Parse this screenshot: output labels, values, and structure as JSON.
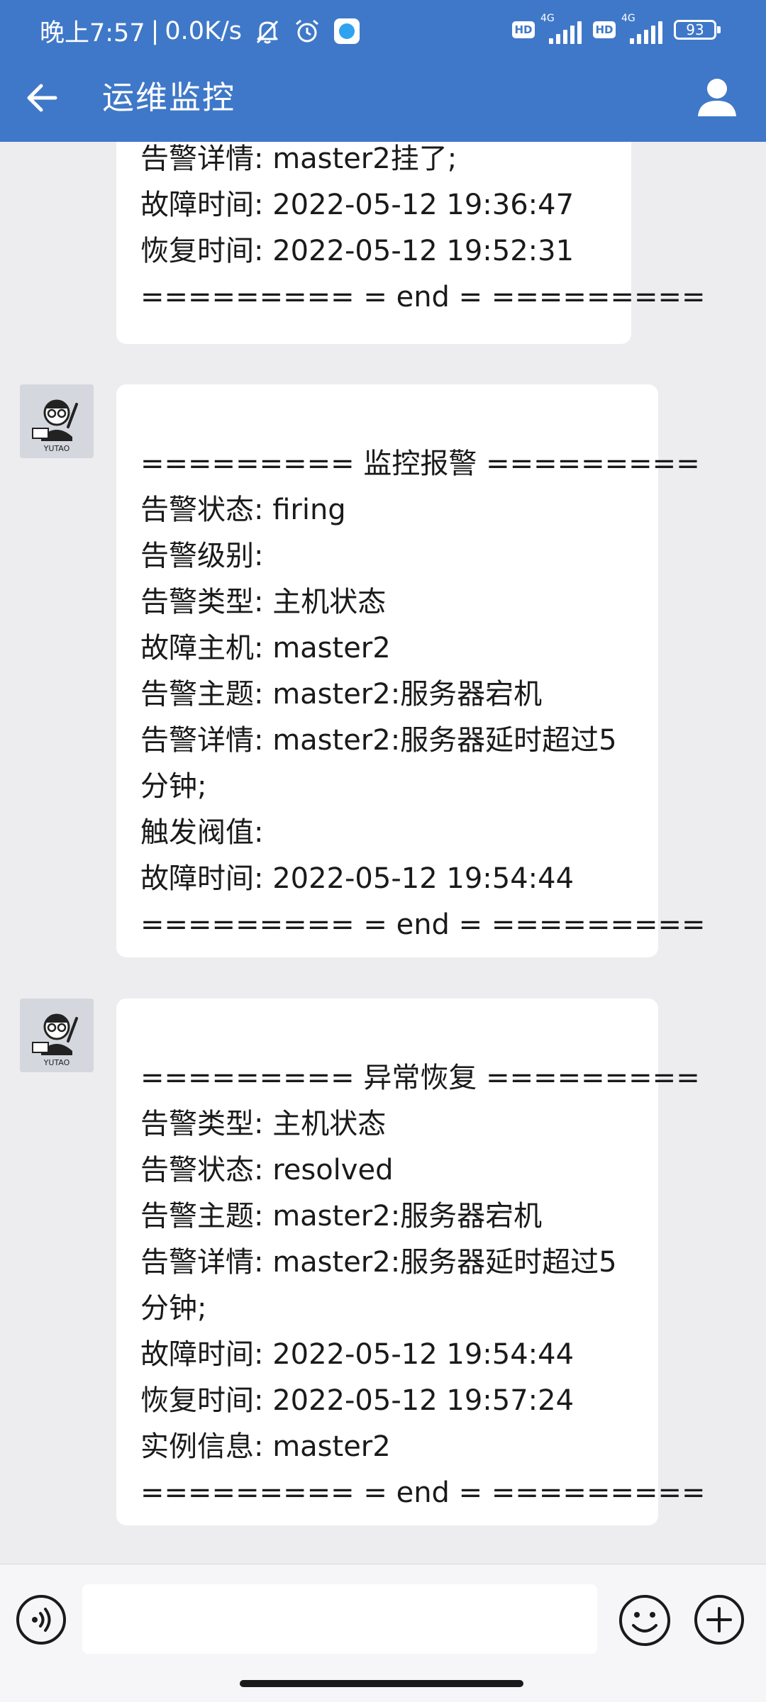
{
  "status_bar": {
    "time": "晚上7:57",
    "separator": "|",
    "speed": "0.0K/s",
    "hd1": "HD",
    "net1": "4G",
    "hd2": "HD",
    "net2": "4G",
    "battery": "93",
    "icons": [
      "mute-bell-icon",
      "alarm-clock-icon",
      "app-notification-icon",
      "signal-icon",
      "battery-icon"
    ]
  },
  "header": {
    "title": "运维监控",
    "back_icon": "arrow-left-icon",
    "profile_icon": "person-icon"
  },
  "messages": [
    {
      "has_avatar": false,
      "lines": [
        "告警详情: master2挂了;",
        "故障时间: 2022-05-12 19:36:47",
        "恢复时间: 2022-05-12 19:52:31",
        "========= = end =  ========="
      ]
    },
    {
      "has_avatar": true,
      "avatar_text": "YUTAO",
      "lines": [
        "",
        "========= 监控报警 =========",
        "告警状态: firing",
        "告警级别:",
        "告警类型: 主机状态",
        "故障主机: master2",
        "告警主题: master2:服务器宕机",
        "告警详情: master2:服务器延时超过5",
        "分钟;",
        "触发阀值:",
        "故障时间: 2022-05-12 19:54:44",
        "========= = end =  ========="
      ]
    },
    {
      "has_avatar": true,
      "avatar_text": "YUTAO",
      "lines": [
        "",
        "========= 异常恢复 =========",
        "告警类型: 主机状态",
        "告警状态: resolved",
        "告警主题: master2:服务器宕机",
        "告警详情: master2:服务器延时超过5",
        "分钟;",
        "故障时间: 2022-05-12 19:54:44",
        "恢复时间: 2022-05-12 19:57:24",
        "实例信息: master2",
        "========= = end =  ========="
      ]
    }
  ],
  "input_bar": {
    "placeholder": "",
    "value": "",
    "voice_icon": "voice-input-icon",
    "emoji_icon": "emoji-icon",
    "plus_icon": "plus-icon"
  },
  "colors": {
    "header_bg": "#3f78c8",
    "chat_bg": "#ededf0",
    "bubble_bg": "#ffffff"
  }
}
